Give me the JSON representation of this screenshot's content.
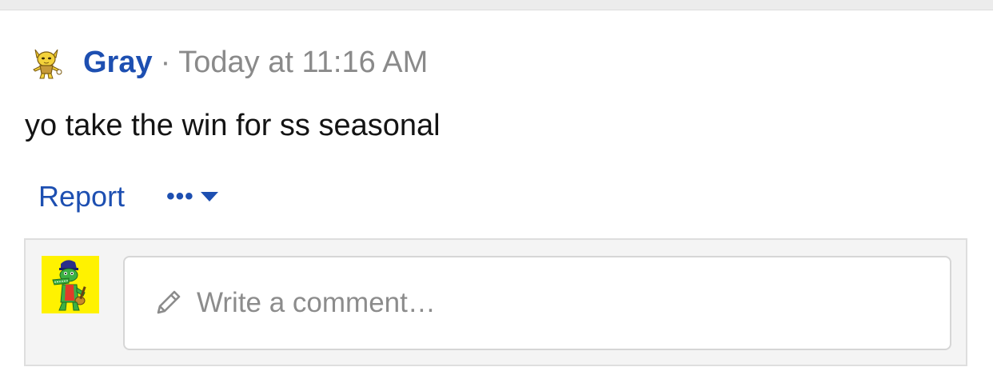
{
  "post": {
    "author": "Gray",
    "separator": "·",
    "timestamp": "Today at 11:16 AM",
    "message": "yo take the win for ss seasonal",
    "actions": {
      "report_label": "Report",
      "more_label": "•••"
    }
  },
  "comment_box": {
    "placeholder": "Write a comment…"
  },
  "icons": {
    "author_avatar": "pokemon-sprite-icon",
    "commenter_avatar": "crocodile-avatar-icon",
    "pencil": "pencil-icon",
    "more_caret": "caret-down-icon"
  },
  "colors": {
    "link": "#1d4fb1",
    "muted": "#8a8a8a",
    "avatar_bg": "#fff200"
  }
}
